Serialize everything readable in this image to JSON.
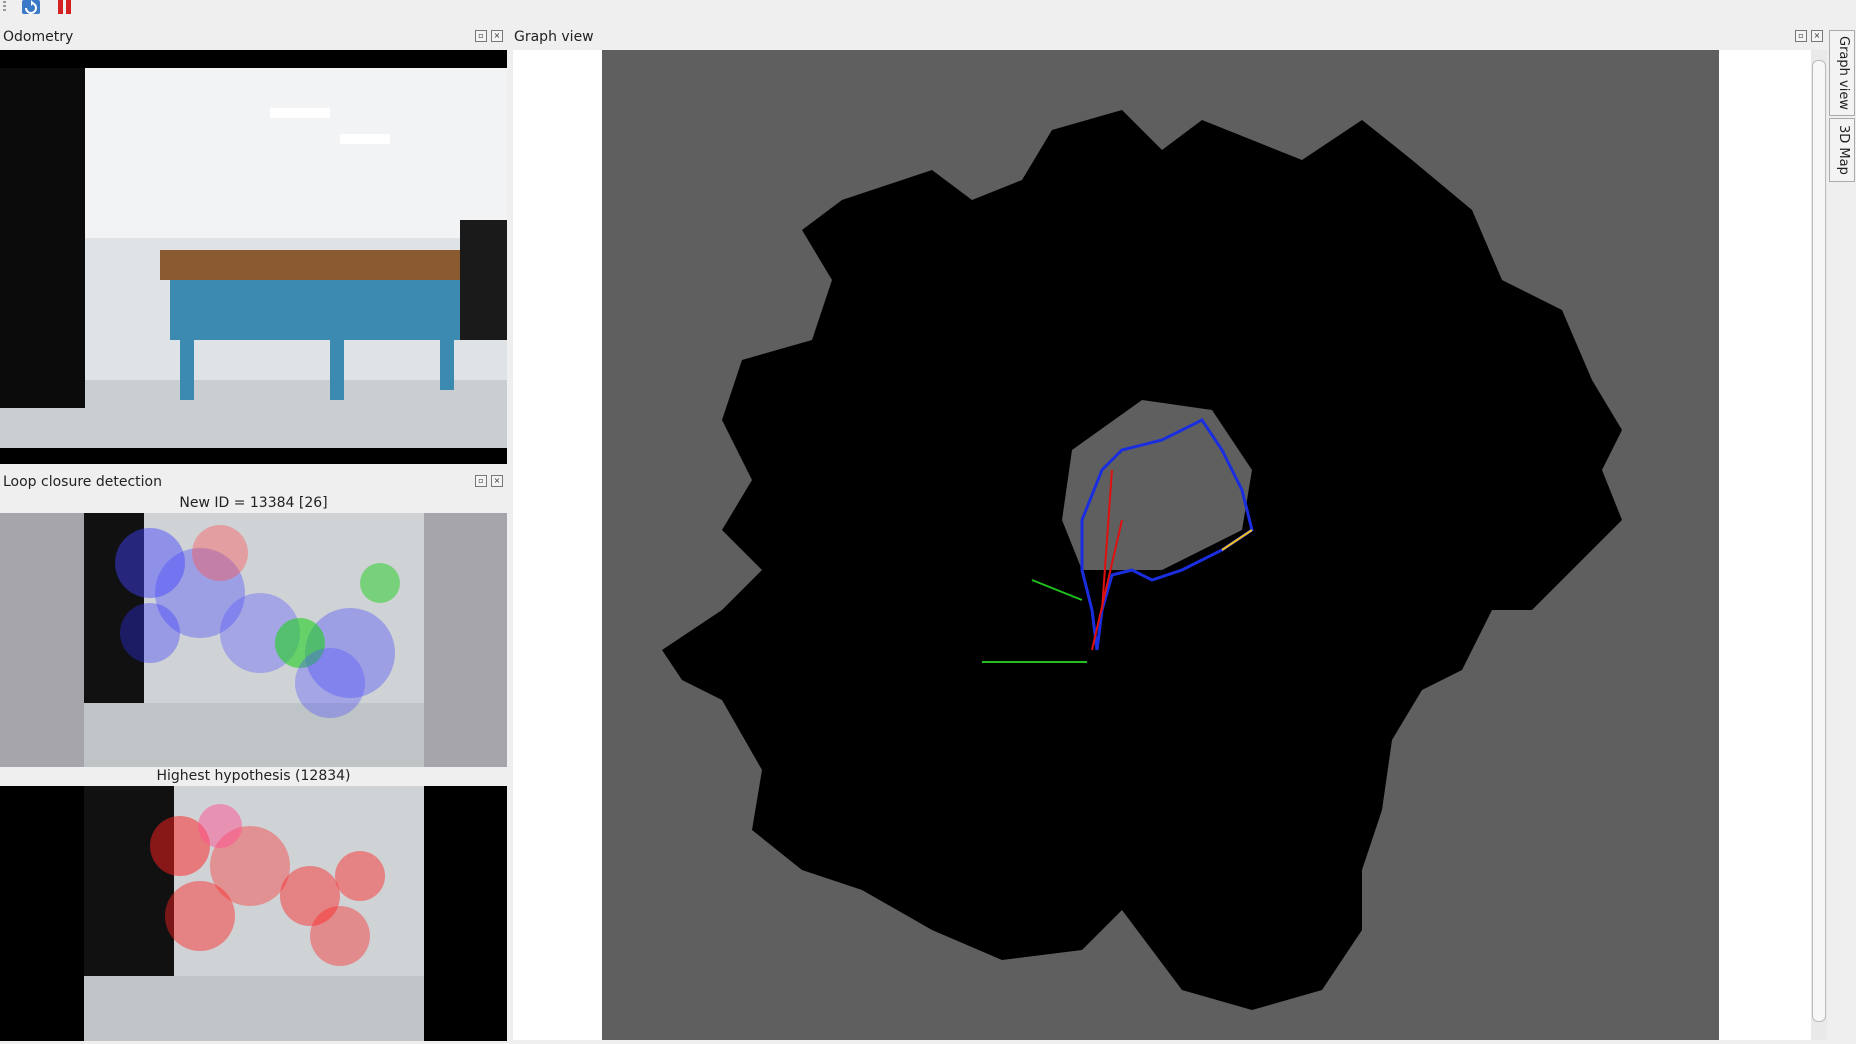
{
  "toolbar": {
    "refresh_icon": "refresh-icon",
    "pause_icon": "pause-icon"
  },
  "odometry": {
    "title": "Odometry"
  },
  "loop_closure": {
    "title": "Loop closure detection",
    "new_id_label": "New ID = 13384 [26]",
    "hypothesis_label": "Highest hypothesis (12834)"
  },
  "graph_view": {
    "title": "Graph view"
  },
  "side_tabs": [
    "Graph view",
    "3D Map"
  ],
  "colors": {
    "trajectory": "#1a2ee0",
    "loop_link": "#e01010",
    "neighbor_link": "#f0c020",
    "x_axis": "#e02020",
    "y_axis": "#20c020"
  }
}
